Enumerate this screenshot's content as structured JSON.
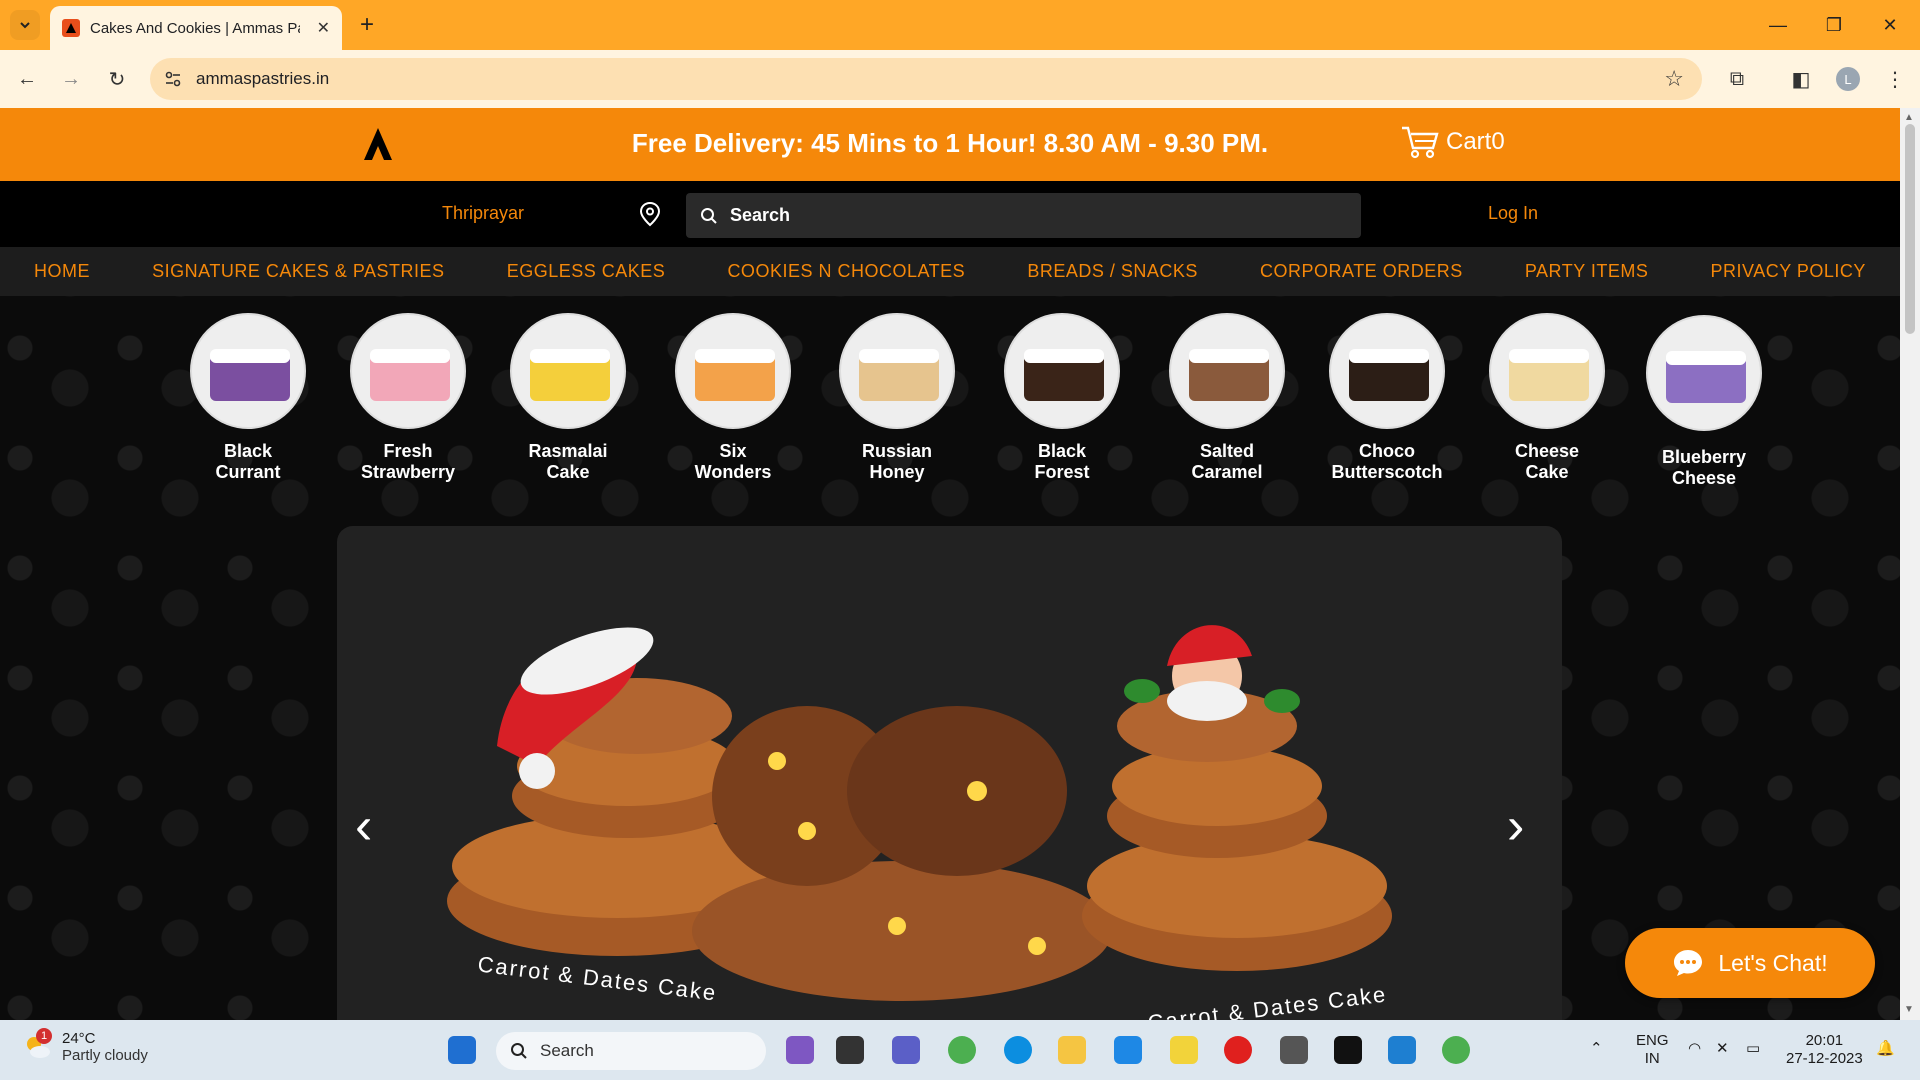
{
  "browser": {
    "tab_title": "Cakes And Cookies | Ammas Pa",
    "url": "ammaspastries.in",
    "profile_initial": "L"
  },
  "site": {
    "promo": "Free Delivery: 45 Mins to 1 Hour! 8.30 AM - 9.30 PM.",
    "cart_label": "Cart0",
    "location": "Thriprayar",
    "search_placeholder": "Search",
    "login": "Log In",
    "menu": [
      "HOME",
      "SIGNATURE CAKES & PASTRIES",
      "EGGLESS CAKES",
      "COOKIES N CHOCOLATES",
      "BREADS / SNACKS",
      "CORPORATE ORDERS",
      "PARTY ITEMS",
      "PRIVACY POLICY"
    ],
    "categories": [
      {
        "line1": "Black",
        "line2": "Currant",
        "color": "#7b4fa0"
      },
      {
        "line1": "Fresh",
        "line2": "Strawberry",
        "color": "#f2a7b8"
      },
      {
        "line1": "Rasmalai",
        "line2": "Cake",
        "color": "#f4cf3b"
      },
      {
        "line1": "Six",
        "line2": "Wonders",
        "color": "#f3a24a"
      },
      {
        "line1": "Russian",
        "line2": "Honey",
        "color": "#e6c48e"
      },
      {
        "line1": "Black",
        "line2": "Forest",
        "color": "#3a2418"
      },
      {
        "line1": "Salted",
        "line2": "Caramel",
        "color": "#8a5a3c"
      },
      {
        "line1": "Choco",
        "line2": "Butterscotch",
        "color": "#2c1e16"
      },
      {
        "line1": "Cheese",
        "line2": "Cake",
        "color": "#f0d9a0"
      },
      {
        "line1": "Blueberry",
        "line2": "Cheese",
        "color": "#8c6fc2"
      }
    ],
    "banner_caption_left": "Carrot & Dates Cake",
    "banner_caption_right": "Carrot & Dates Cake",
    "chat_label": "Let's Chat!"
  },
  "taskbar": {
    "weather_badge": "1",
    "temperature": "24°C",
    "weather": "Partly cloudy",
    "search": "Search",
    "lang_top": "ENG",
    "lang_bottom": "IN",
    "time": "20:01",
    "date": "27-12-2023"
  }
}
